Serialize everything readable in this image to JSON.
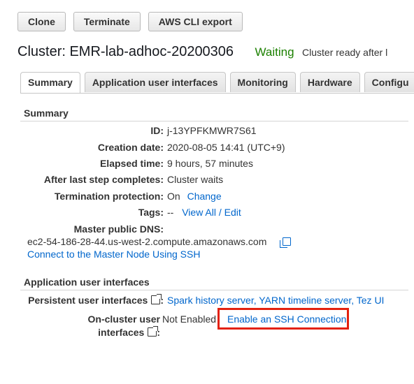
{
  "toolbar": {
    "clone": "Clone",
    "terminate": "Terminate",
    "cli_export": "AWS CLI export"
  },
  "cluster": {
    "title": "Cluster: EMR-lab-adhoc-20200306",
    "status": "Waiting",
    "status_message": "Cluster ready after l"
  },
  "tabs": [
    "Summary",
    "Application user interfaces",
    "Monitoring",
    "Hardware",
    "Configu"
  ],
  "summary": {
    "heading": "Summary",
    "id_label": "ID:",
    "id_value": "j-13YPFKMWR7S61",
    "creation_label": "Creation date:",
    "creation_value": "2020-08-05 14:41 (UTC+9)",
    "elapsed_label": "Elapsed time:",
    "elapsed_value": "9 hours, 57 minutes",
    "after_step_label": "After last step completes:",
    "after_step_value": "Cluster waits",
    "termination_label": "Termination protection:",
    "termination_value": "On",
    "termination_change": "Change",
    "tags_label": "Tags:",
    "tags_value": "--",
    "tags_link": "View All / Edit",
    "dns_label": "Master public DNS:",
    "dns_value": "ec2-54-186-28-44.us-west-2.compute.amazonaws.com",
    "ssh_link": "Connect to the Master Node Using SSH"
  },
  "app_ui": {
    "heading": "Application user interfaces",
    "persistent_label": "Persistent user interfaces",
    "persistent_links": "Spark history server, YARN timeline server, Tez UI",
    "oncluster_label_1": "On-cluster user",
    "oncluster_label_2": "interfaces",
    "oncluster_value": "Not Enabled",
    "oncluster_link": "Enable an SSH Connection"
  },
  "colors": {
    "status": "#1d8102",
    "link": "#0066cc",
    "highlight": "#e3210f"
  }
}
